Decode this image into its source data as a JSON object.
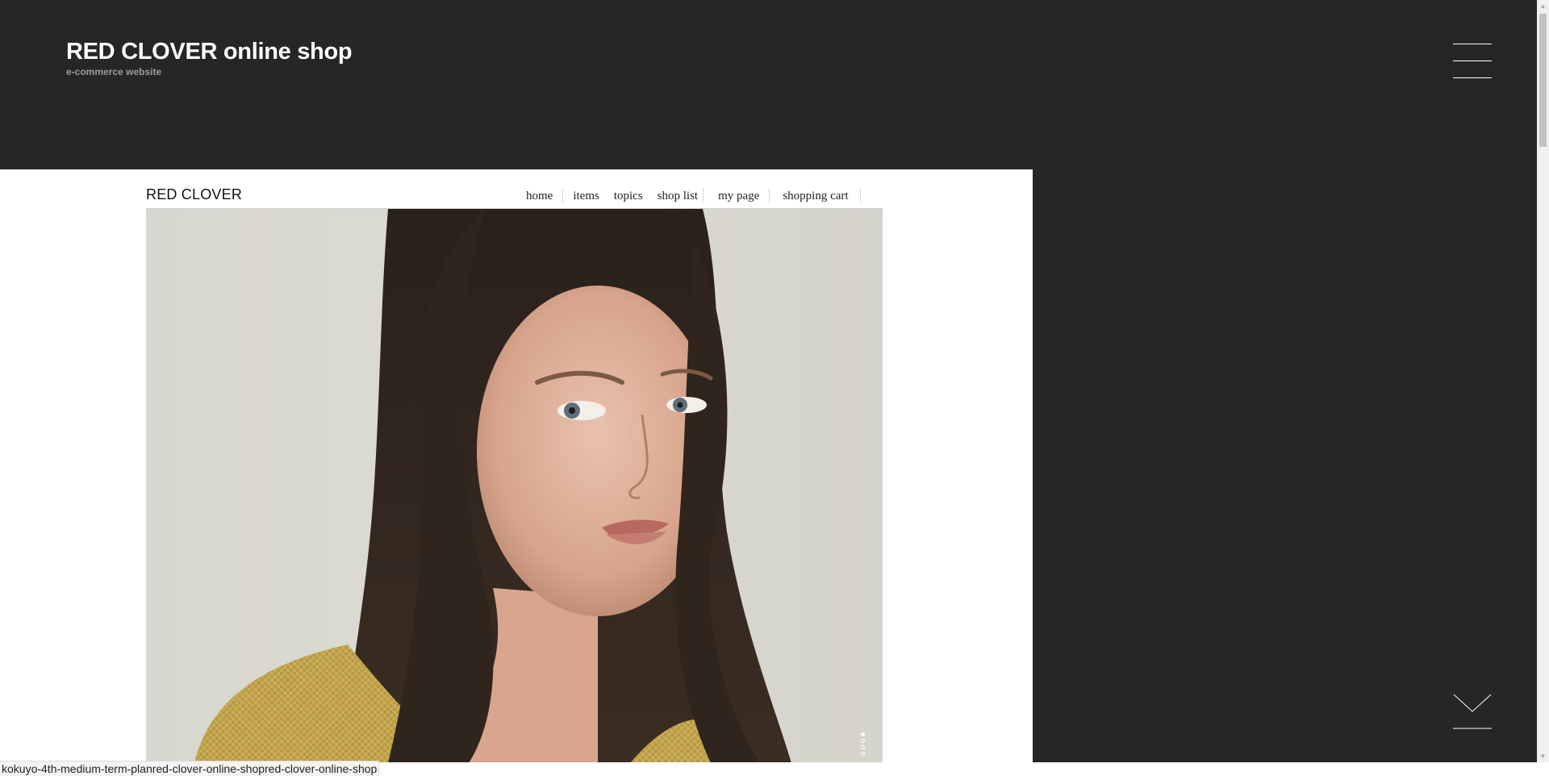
{
  "header": {
    "title": "RED CLOVER online shop",
    "subtitle": "e-commerce website",
    "menu_icon": "hamburger-menu-icon",
    "scroll_icon": "chevron-down-icon"
  },
  "preview": {
    "brand": "RED CLOVER",
    "nav": [
      {
        "label": "home"
      },
      {
        "label": "items"
      },
      {
        "label": "topics"
      },
      {
        "label": "shop list"
      },
      {
        "label": "my page"
      },
      {
        "label": "shopping cart"
      }
    ],
    "hero_image": "portrait of woman with long dark hair in yellow mohair sweater",
    "slider_dots": 4,
    "active_dot": 1
  },
  "status_bar": {
    "url": "kokuyo-4th-medium-term-planred-clover-online-shopred-clover-online-shop"
  },
  "colors": {
    "background_dark": "#262626",
    "title": "#ffffff",
    "subtitle": "#9a9a9a",
    "preview_bg": "#ffffff",
    "sweater": "#b69a3f"
  }
}
